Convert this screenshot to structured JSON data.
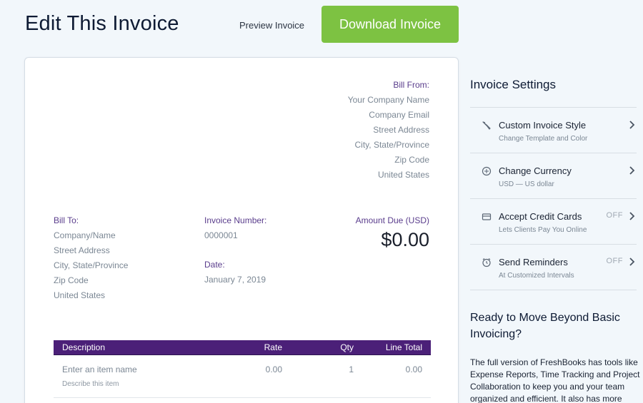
{
  "header": {
    "title": "Edit This Invoice",
    "preview_label": "Preview Invoice",
    "download_label": "Download Invoice"
  },
  "invoice": {
    "bill_from": {
      "label": "Bill From:",
      "lines": [
        "Your Company Name",
        "Company Email",
        "Street Address",
        "City, State/Province",
        "Zip Code",
        "United States"
      ]
    },
    "bill_to": {
      "label": "Bill To:",
      "lines": [
        "Company/Name",
        "Street Address",
        "City, State/Province",
        "Zip Code",
        "United States"
      ]
    },
    "invoice_number": {
      "label": "Invoice Number:",
      "value": "0000001"
    },
    "date": {
      "label": "Date:",
      "value": "January 7, 2019"
    },
    "amount_due": {
      "label": "Amount Due (USD)",
      "value": "$0.00"
    },
    "table": {
      "headers": {
        "description": "Description",
        "rate": "Rate",
        "qty": "Qty",
        "total": "Line Total"
      },
      "rows": [
        {
          "name": "Enter an item name",
          "sub": "Describe this item",
          "rate": "0.00",
          "qty": "1",
          "total": "0.00"
        }
      ]
    }
  },
  "settings": {
    "title": "Invoice Settings",
    "items": [
      {
        "icon": "brush-icon",
        "label": "Custom Invoice Style",
        "sub": "Change Template and Color",
        "toggle": ""
      },
      {
        "icon": "currency-icon",
        "label": "Change Currency",
        "sub": "USD — US dollar",
        "toggle": ""
      },
      {
        "icon": "credit-card-icon",
        "label": "Accept Credit Cards",
        "sub": "Lets Clients Pay You Online",
        "toggle": "OFF"
      },
      {
        "icon": "alarm-clock-icon",
        "label": "Send Reminders",
        "sub": "At Customized Intervals",
        "toggle": "OFF"
      }
    ]
  },
  "promo": {
    "title": "Ready to Move Beyond Basic Invoicing?",
    "body": "The full version of FreshBooks has tools like Expense Reports, Time Tracking and Project Collaboration to keep you and your team organized and efficient. It also has more"
  },
  "colors": {
    "accent_green": "#7dc242",
    "table_header": "#4b2078",
    "label_purple": "#5a3d8c"
  }
}
